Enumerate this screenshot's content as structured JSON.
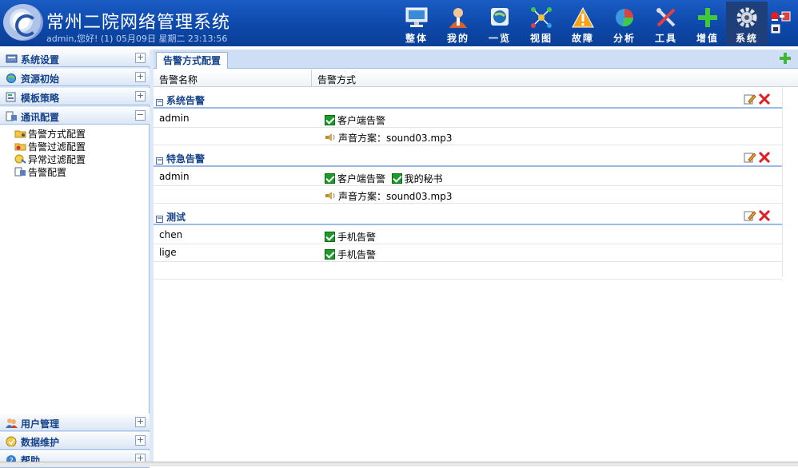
{
  "header": {
    "title": "常州二院网络管理系统",
    "user_line": "admin,您好! (1) 05月09日 星期二 23:13:56",
    "nav": [
      {
        "label": "整体",
        "icon": "monitor-icon"
      },
      {
        "label": "我的",
        "icon": "person-icon"
      },
      {
        "label": "一览",
        "icon": "globe-icon"
      },
      {
        "label": "视图",
        "icon": "topology-icon"
      },
      {
        "label": "故障",
        "icon": "warning-icon"
      },
      {
        "label": "分析",
        "icon": "pie-chart-icon"
      },
      {
        "label": "工具",
        "icon": "tools-icon"
      },
      {
        "label": "增值",
        "icon": "plus-icon"
      },
      {
        "label": "系统",
        "icon": "gear-icon"
      }
    ]
  },
  "sidebar": {
    "top_sections": [
      {
        "label": "系统设置",
        "toggle": "+"
      },
      {
        "label": "资源初始",
        "toggle": "+"
      },
      {
        "label": "模板策略",
        "toggle": "+"
      },
      {
        "label": "通讯配置",
        "toggle": "−"
      }
    ],
    "tree": [
      "告警方式配置",
      "告警过滤配置",
      "异常过滤配置",
      "告警配置"
    ],
    "bottom_sections": [
      {
        "label": "用户管理",
        "toggle": "+"
      },
      {
        "label": "数据维护",
        "toggle": "+"
      },
      {
        "label": "帮助",
        "toggle": "+"
      }
    ]
  },
  "main": {
    "tab": "告警方式配置",
    "columns": [
      "告警名称",
      "告警方式"
    ],
    "groups": [
      {
        "name": "系统告警",
        "rows": [
          {
            "user": "admin",
            "methods": [
              "客户端告警"
            ]
          },
          {
            "user": "",
            "sound": "声音方案：sound03.mp3"
          }
        ]
      },
      {
        "name": "特急告警",
        "rows": [
          {
            "user": "admin",
            "methods": [
              "客户端告警",
              "我的秘书"
            ]
          },
          {
            "user": "",
            "sound": "声音方案：sound03.mp3"
          }
        ]
      },
      {
        "name": "测试",
        "rows": [
          {
            "user": "chen",
            "methods": [
              "手机告警"
            ]
          },
          {
            "user": "lige",
            "methods": [
              "手机告警"
            ]
          }
        ]
      }
    ]
  }
}
